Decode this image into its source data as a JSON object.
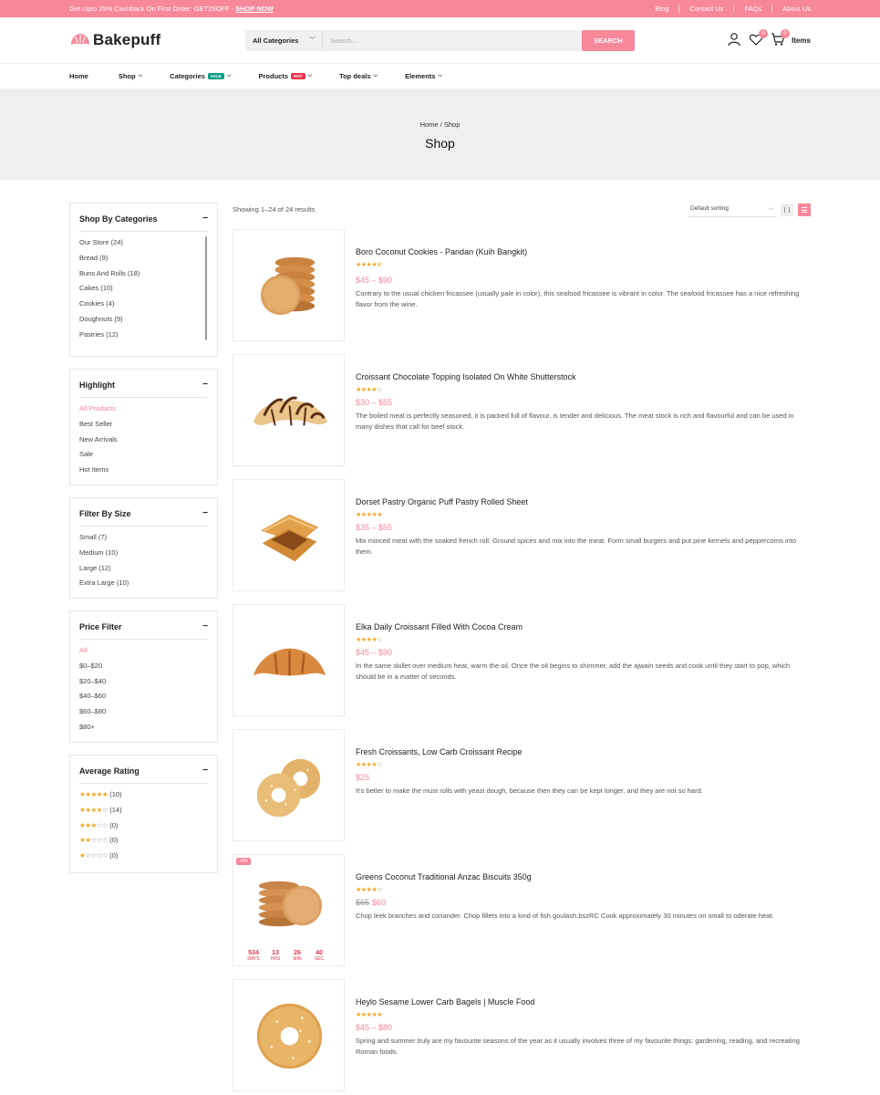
{
  "topbar": {
    "promo_text": "Get Upto 25% Cashback On First Order: GET25OFF - ",
    "promo_link": "SHOP NOW",
    "links": [
      "Blog",
      "Contact Us",
      "FAQs",
      "About Us"
    ]
  },
  "header": {
    "logo_text": "Bakepuff",
    "category_select": "All Categories",
    "search_placeholder": "Search...",
    "search_button": "SEARCH",
    "wishlist_count": "0",
    "cart_count": "0",
    "cart_label": "Items"
  },
  "nav": {
    "items": [
      {
        "label": "Home"
      },
      {
        "label": "Shop"
      },
      {
        "label": "Categories",
        "tag": "SALE"
      },
      {
        "label": "Products",
        "tag": "HOT"
      },
      {
        "label": "Top deals"
      },
      {
        "label": "Elements"
      }
    ]
  },
  "hero": {
    "breadcrumb_home": "Home",
    "breadcrumb_sep": " / ",
    "breadcrumb_current": "Shop",
    "title": "Shop"
  },
  "sidebar": {
    "categories": {
      "title": "Shop By Categories",
      "items": [
        "Our Store (24)",
        "Bread (9)",
        "Buns And Rolls (18)",
        "Cakes (10)",
        "Cookies (4)",
        "Doughnuts (9)",
        "Pastries (12)"
      ]
    },
    "highlight": {
      "title": "Highlight",
      "items": [
        "All Products",
        "Best Seller",
        "New Arrivals",
        "Sale",
        "Hot Items"
      ]
    },
    "size": {
      "title": "Filter By Size",
      "items": [
        "Small (7)",
        "Medium (10)",
        "Large (12)",
        "Extra Large (10)"
      ]
    },
    "price": {
      "title": "Price Filter",
      "items": [
        "All",
        "$0–$20",
        "$20–$40",
        "$40–$60",
        "$60–$80",
        "$80+"
      ]
    },
    "rating": {
      "title": "Average Rating",
      "items": [
        {
          "stars": 5,
          "count": "(10)"
        },
        {
          "stars": 4,
          "count": "(14)"
        },
        {
          "stars": 3,
          "count": "(0)"
        },
        {
          "stars": 2,
          "count": "(0)"
        },
        {
          "stars": 1,
          "count": "(0)"
        }
      ]
    }
  },
  "toolbar": {
    "result_count": "Showing 1–24 of 24 results",
    "sorting": "Default sorting"
  },
  "products": [
    {
      "name": "Boro Coconut Cookies - Pandan (Kuih Bangkit)",
      "rating": 4.5,
      "price": "$45 – $90",
      "desc": "Contrary to the usual chicken fricassee (usually pale in color), this seafood fricassee is vibrant in color. The seafood fricassee has a nice refreshing flavor from the wine.",
      "image": "cookie-stack"
    },
    {
      "name": "Croissant Chocolate Topping Isolated On White Shutterstock",
      "rating": 4,
      "price": "$30 – $55",
      "desc": "The boiled meat is perfectly seasoned, it is packed full of flavour, is tender and delicious. The meat stock is rich and flavourful and can be used in many dishes that call for beef stock.",
      "image": "chocolate-croissant"
    },
    {
      "name": "Dorset Pastry Organic Puff Pastry Rolled Sheet",
      "rating": 5,
      "price": "$35 – $55",
      "desc": "Mix minced meat with the soaked french roll. Ground spices and mix into the meat. Form small burgers and put pine kernels and peppercorns into them.",
      "image": "puff-pastry"
    },
    {
      "name": "Elka Daily Croissant Filled With Cocoa Cream",
      "rating": 4,
      "price": "$45 – $90",
      "desc": "In the same skillet over medium heat, warm the oil. Once the oil begins to shimmer, add the ajwain seeds and cook until they start to pop, which should be in a matter of seconds.",
      "image": "croissant"
    },
    {
      "name": "Fresh Croissants, Low Carb Croissant Recipe",
      "rating": 4,
      "price": "$25",
      "desc": "It's better to make the must rolls with yeast dough, because then they can be kept longer, and they are not so hard.",
      "image": "sesame-rings"
    },
    {
      "name": "Greens Coconut Traditional Anzac Biscuits 350g",
      "rating": 4,
      "price_old": "$65",
      "price": "$60",
      "sale_badge": "-8%",
      "countdown": [
        {
          "num": "534",
          "label": "DAYS"
        },
        {
          "num": "13",
          "label": "HRS"
        },
        {
          "num": "26",
          "label": "MIN"
        },
        {
          "num": "40",
          "label": "SEC"
        }
      ],
      "desc": "Chop leek branches and coriander. Chop fillets into a kind of fish goulash.bszRC Cook approximately 30 minutes on small to  oderate heat.",
      "image": "biscuits"
    },
    {
      "name": "Heylo Sesame Lower Carb Bagels | Muscle Food",
      "rating": 5,
      "price": "$45 – $80",
      "desc": "Spring and summer truly are my favourite seasons of the year as it usually involves three of my favourite things: gardening, reading, and recreating Roman foods.",
      "image": "bagel"
    }
  ],
  "colors": {
    "accent": "#f6889a",
    "star": "#f5a623",
    "sale_tag": "#0f9d84",
    "hot_tag": "#e8344e"
  }
}
